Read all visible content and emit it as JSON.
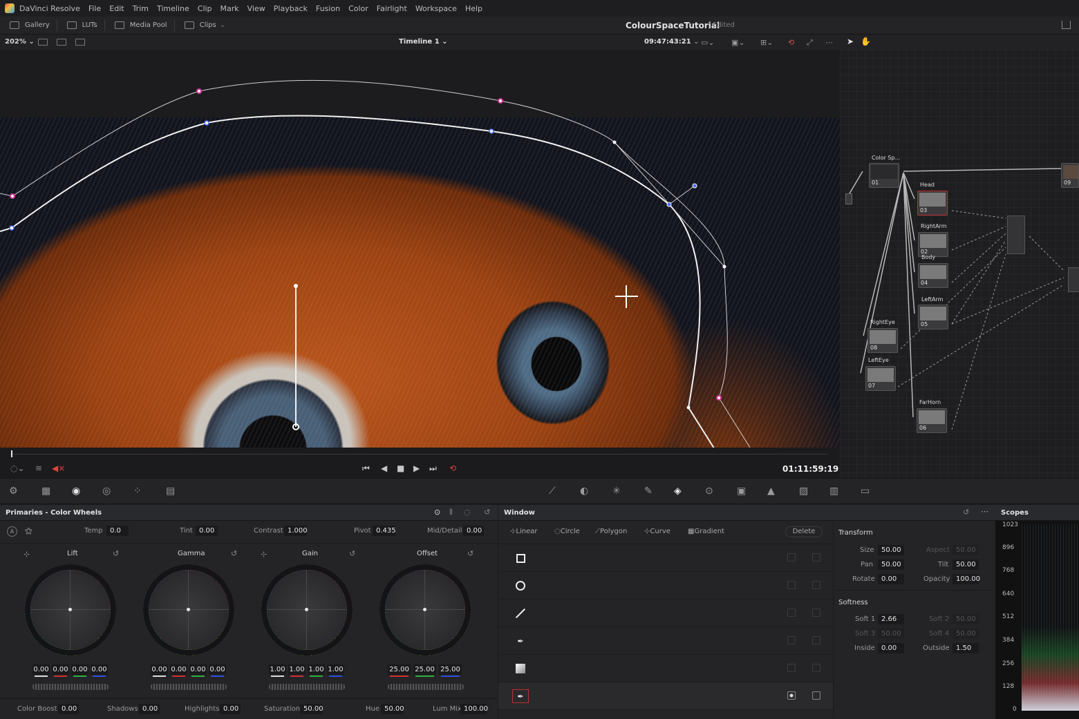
{
  "menu": [
    "DaVinci Resolve",
    "File",
    "Edit",
    "Trim",
    "Timeline",
    "Clip",
    "Mark",
    "View",
    "Playback",
    "Fusion",
    "Color",
    "Fairlight",
    "Workspace",
    "Help"
  ],
  "toolbar": {
    "gallery": "Gallery",
    "luts": "LUTs",
    "media_pool": "Media Pool",
    "clips": "Clips"
  },
  "project": {
    "title": "ColourSpaceTutorial",
    "status": "Edited"
  },
  "viewer": {
    "zoom": "202%",
    "timeline": "Timeline 1",
    "timecode": "09:47:43:21",
    "playhead_tc": "01:11:59:19"
  },
  "nodes": [
    {
      "label": "Color Sp...",
      "num": "01"
    },
    {
      "label": "Head",
      "num": "03"
    },
    {
      "label": "RightArm",
      "num": "02"
    },
    {
      "label": "Body",
      "num": "04"
    },
    {
      "label": "LeftArm",
      "num": "05"
    },
    {
      "label": "RightEye",
      "num": "08"
    },
    {
      "label": "LeftEye",
      "num": "07"
    },
    {
      "label": "FarHorn",
      "num": "06"
    },
    {
      "label": "",
      "num": "09"
    }
  ],
  "primaries": {
    "title": "Primaries - Color Wheels",
    "temp_label": "Temp",
    "temp": "0.0",
    "tint_label": "Tint",
    "tint": "0.00",
    "contrast_label": "Contrast",
    "contrast": "1.000",
    "pivot_label": "Pivot",
    "pivot": "0.435",
    "middetail_label": "Mid/Detail",
    "middetail": "0.00",
    "wheels": [
      {
        "name": "Lift",
        "values": [
          "0.00",
          "0.00",
          "0.00",
          "0.00"
        ]
      },
      {
        "name": "Gamma",
        "values": [
          "0.00",
          "0.00",
          "0.00",
          "0.00"
        ]
      },
      {
        "name": "Gain",
        "values": [
          "1.00",
          "1.00",
          "1.00",
          "1.00"
        ]
      },
      {
        "name": "Offset",
        "values": [
          "25.00",
          "25.00",
          "25.00"
        ]
      }
    ],
    "colorboost_label": "Color Boost",
    "colorboost": "0.00",
    "shadows_label": "Shadows",
    "shadows": "0.00",
    "highlights_label": "Highlights",
    "highlights": "0.00",
    "saturation_label": "Saturation",
    "saturation": "50.00",
    "hue_label": "Hue",
    "hue": "50.00",
    "lummix_label": "Lum Mix",
    "lummix": "100.00"
  },
  "window": {
    "title": "Window",
    "shapes": [
      "Linear",
      "Circle",
      "Polygon",
      "Curve",
      "Gradient"
    ],
    "delete": "Delete",
    "transform_title": "Transform",
    "size_label": "Size",
    "size": "50.00",
    "aspect_label": "Aspect",
    "aspect": "50.00",
    "pan_label": "Pan",
    "pan": "50.00",
    "tilt_label": "Tilt",
    "tilt": "50.00",
    "rotate_label": "Rotate",
    "rotate": "0.00",
    "opacity_label": "Opacity",
    "opacity": "100.00",
    "softness_title": "Softness",
    "soft1_label": "Soft 1",
    "soft1": "2.66",
    "soft2_label": "Soft 2",
    "soft2": "50.00",
    "soft3_label": "Soft 3",
    "soft3": "50.00",
    "soft4_label": "Soft 4",
    "soft4": "50.00",
    "inside_label": "Inside",
    "inside": "0.00",
    "outside_label": "Outside",
    "outside": "1.50"
  },
  "scopes": {
    "title": "Scopes",
    "scale": [
      "1023",
      "896",
      "768",
      "640",
      "512",
      "384",
      "256",
      "128",
      "0"
    ]
  },
  "colors": {
    "accent_red": "#c03030",
    "curve_point": "#d0399a",
    "tangent_blue": "#4a6cff"
  }
}
